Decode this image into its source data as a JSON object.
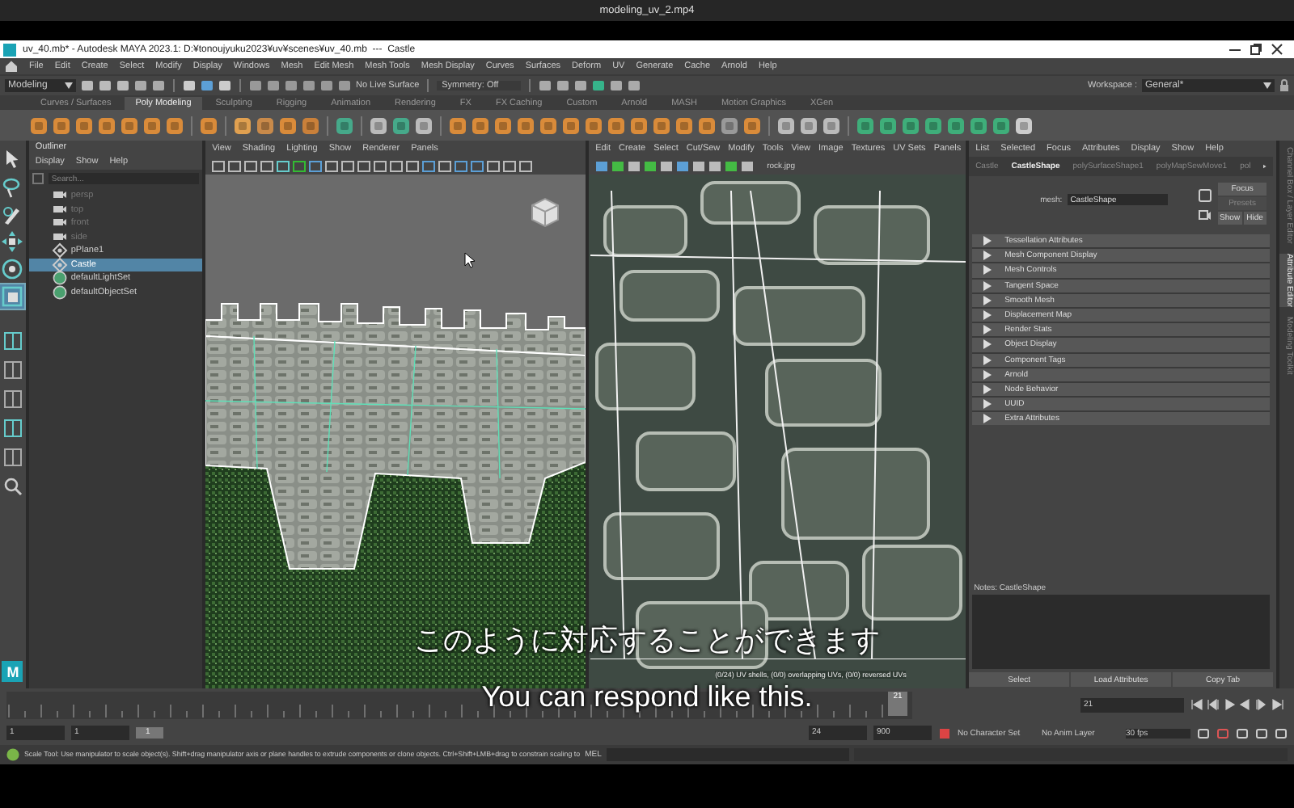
{
  "player": {
    "title": "modeling_uv_2.mp4"
  },
  "window": {
    "title": "uv_40.mb* - Autodesk MAYA 2023.1: D:¥tonoujyuku2023¥uv¥scenes¥uv_40.mb  ---  Castle"
  },
  "menu_bar": [
    "File",
    "Edit",
    "Create",
    "Select",
    "Modify",
    "Display",
    "Windows",
    "Mesh",
    "Edit Mesh",
    "Mesh Tools",
    "Mesh Display",
    "Curves",
    "Surfaces",
    "Deform",
    "UV",
    "Generate",
    "Cache",
    "Arnold",
    "Help"
  ],
  "status_line": {
    "mode": "Modeling",
    "live_surface": "No Live Surface",
    "symmetry": "Symmetry: Off",
    "workspace_label": "Workspace :",
    "workspace": "General*"
  },
  "shelf_tabs": [
    {
      "label": "Curves / Surfaces",
      "selected": false
    },
    {
      "label": "Poly Modeling",
      "selected": true
    },
    {
      "label": "Sculpting",
      "selected": false
    },
    {
      "label": "Rigging",
      "selected": false
    },
    {
      "label": "Animation",
      "selected": false
    },
    {
      "label": "Rendering",
      "selected": false
    },
    {
      "label": "FX",
      "selected": false
    },
    {
      "label": "FX Caching",
      "selected": false
    },
    {
      "label": "Custom",
      "selected": false
    },
    {
      "label": "Arnold",
      "selected": false
    },
    {
      "label": "MASH",
      "selected": false
    },
    {
      "label": "Motion Graphics",
      "selected": false
    },
    {
      "label": "XGen",
      "selected": false
    }
  ],
  "toolbox": [
    {
      "kind": "select",
      "selected": false
    },
    {
      "kind": "lasso",
      "selected": false
    },
    {
      "kind": "paint",
      "selected": false
    },
    {
      "kind": "move",
      "selected": false
    },
    {
      "kind": "rotate",
      "selected": false
    },
    {
      "kind": "scale",
      "selected": true
    }
  ],
  "outliner": {
    "title": "Outliner",
    "menus": [
      "Display",
      "Show",
      "Help"
    ],
    "search_placeholder": "Search...",
    "items": [
      {
        "label": "persp",
        "kind": "camera",
        "dimmed": true,
        "selected": false
      },
      {
        "label": "top",
        "kind": "camera",
        "dimmed": true,
        "selected": false
      },
      {
        "label": "front",
        "kind": "camera",
        "dimmed": true,
        "selected": false
      },
      {
        "label": "side",
        "kind": "camera",
        "dimmed": true,
        "selected": false
      },
      {
        "label": "pPlane1",
        "kind": "mesh",
        "dimmed": false,
        "selected": false
      },
      {
        "label": "Castle",
        "kind": "mesh",
        "dimmed": false,
        "selected": true
      },
      {
        "label": "defaultLightSet",
        "kind": "set",
        "dimmed": false,
        "selected": false
      },
      {
        "label": "defaultObjectSet",
        "kind": "set",
        "dimmed": false,
        "selected": false
      }
    ]
  },
  "viewport": {
    "menus": [
      "View",
      "Shading",
      "Lighting",
      "Show",
      "Renderer",
      "Panels"
    ]
  },
  "uv_editor": {
    "menus": [
      "Edit",
      "Create",
      "Select",
      "Cut/Sew",
      "Modify",
      "Tools",
      "View",
      "Image",
      "Textures",
      "UV Sets",
      "Panels"
    ],
    "texture": "rock.jpg",
    "info": "(0/24) UV shells, (0/0) overlapping UVs, (0/0) reversed UVs"
  },
  "attribute_editor": {
    "menus": [
      "List",
      "Selected",
      "Focus",
      "Attributes",
      "Display",
      "Show",
      "Help"
    ],
    "tabs": [
      {
        "label": "Castle",
        "selected": false
      },
      {
        "label": "CastleShape",
        "selected": true
      },
      {
        "label": "polySurfaceShape1",
        "selected": false
      },
      {
        "label": "polyMapSewMove1",
        "selected": false
      },
      {
        "label": "pol",
        "selected": false
      }
    ],
    "node_label": "mesh:",
    "node_value": "CastleShape",
    "buttons": [
      "Focus",
      "Presets",
      "Show",
      "Hide"
    ],
    "sections": [
      {
        "label": "Tessellation Attributes",
        "expanded": false
      },
      {
        "label": "Mesh Component Display",
        "expanded": false
      },
      {
        "label": "Mesh Controls",
        "expanded": false
      },
      {
        "label": "Tangent Space",
        "expanded": false
      },
      {
        "label": "Smooth Mesh",
        "expanded": false
      },
      {
        "label": "Displacement Map",
        "expanded": false
      },
      {
        "label": "Render Stats",
        "expanded": false
      },
      {
        "label": "Object Display",
        "expanded": false
      },
      {
        "label": "Component Tags",
        "expanded": false
      },
      {
        "label": "Arnold",
        "expanded": false
      },
      {
        "label": "Node Behavior",
        "expanded": false
      },
      {
        "label": "UUID",
        "expanded": false
      },
      {
        "label": "Extra Attributes",
        "expanded": false
      }
    ],
    "notes_label": "Notes:  CastleShape",
    "bottom_buttons": [
      "Select",
      "Load Attributes",
      "Copy Tab"
    ]
  },
  "side_tabs": [
    {
      "label": "Channel Box / Layer Editor",
      "selected": false
    },
    {
      "label": "Attribute Editor",
      "selected": true
    },
    {
      "label": "Modeling Toolkit",
      "selected": false
    }
  ],
  "time_slider": {
    "current_frame": "21",
    "frame_field": "21"
  },
  "range_slider": {
    "start": "1",
    "playback_start": "1",
    "range_label": "1",
    "playback_end": "24",
    "end": "900",
    "character_set": "No Character Set",
    "anim_layer": "No Anim Layer",
    "fps": "30 fps"
  },
  "help_line": {
    "text": "Scale Tool: Use manipulator to scale object(s). Shift+drag manipulator axis or plane handles to extrude components or clone objects. Ctrl+Shift+LMB+drag to constrain scaling to",
    "mel": "MEL"
  },
  "logo": "M",
  "subtitles": {
    "japanese": "このように対応することができます",
    "english": "You can respond like this."
  }
}
